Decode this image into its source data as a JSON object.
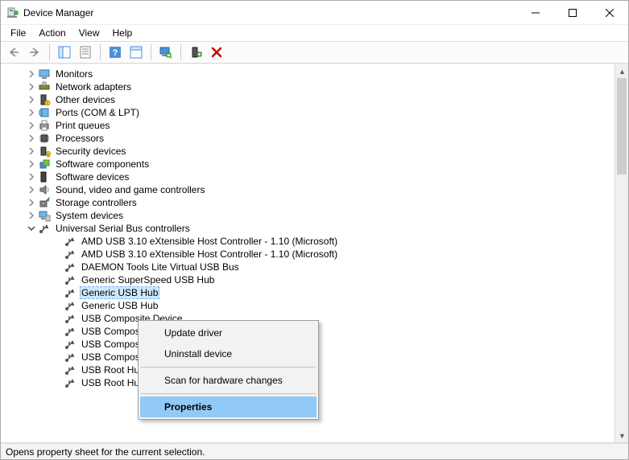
{
  "window": {
    "title": "Device Manager"
  },
  "menu": {
    "items": [
      "File",
      "Action",
      "View",
      "Help"
    ]
  },
  "toolbar": {
    "back": "Back",
    "forward": "Forward",
    "show_hide": "Show/Hide Console Tree",
    "properties": "Properties",
    "help": "Help",
    "action": "Action",
    "view": "View",
    "scan": "Scan for hardware changes",
    "uninstall": "Uninstall device"
  },
  "tree": {
    "categories": [
      {
        "label": "Monitors",
        "icon": "monitor"
      },
      {
        "label": "Network adapters",
        "icon": "network"
      },
      {
        "label": "Other devices",
        "icon": "other"
      },
      {
        "label": "Ports (COM & LPT)",
        "icon": "port"
      },
      {
        "label": "Print queues",
        "icon": "printer"
      },
      {
        "label": "Processors",
        "icon": "cpu"
      },
      {
        "label": "Security devices",
        "icon": "security"
      },
      {
        "label": "Software components",
        "icon": "software-comp"
      },
      {
        "label": "Software devices",
        "icon": "software-dev"
      },
      {
        "label": "Sound, video and game controllers",
        "icon": "sound"
      },
      {
        "label": "Storage controllers",
        "icon": "storage"
      },
      {
        "label": "System devices",
        "icon": "system"
      }
    ],
    "usb_category": {
      "label": "Universal Serial Bus controllers",
      "icon": "usb"
    },
    "usb_devices": [
      {
        "label": "AMD USB 3.10 eXtensible Host Controller - 1.10 (Microsoft)"
      },
      {
        "label": "AMD USB 3.10 eXtensible Host Controller - 1.10 (Microsoft)"
      },
      {
        "label": "DAEMON Tools Lite Virtual USB Bus"
      },
      {
        "label": "Generic SuperSpeed USB Hub"
      },
      {
        "label": "Generic USB Hub",
        "selected": true
      },
      {
        "label": "Generic USB Hub"
      },
      {
        "label": "USB Composite Device"
      },
      {
        "label": "USB Composite Device"
      },
      {
        "label": "USB Composite Device"
      },
      {
        "label": "USB Composite Device"
      },
      {
        "label": "USB Root Hub (USB 3.0)"
      },
      {
        "label": "USB Root Hub (USB 3.0)"
      }
    ]
  },
  "context_menu": {
    "update_driver": "Update driver",
    "uninstall": "Uninstall device",
    "scan": "Scan for hardware changes",
    "properties": "Properties"
  },
  "status": "Opens property sheet for the current selection."
}
